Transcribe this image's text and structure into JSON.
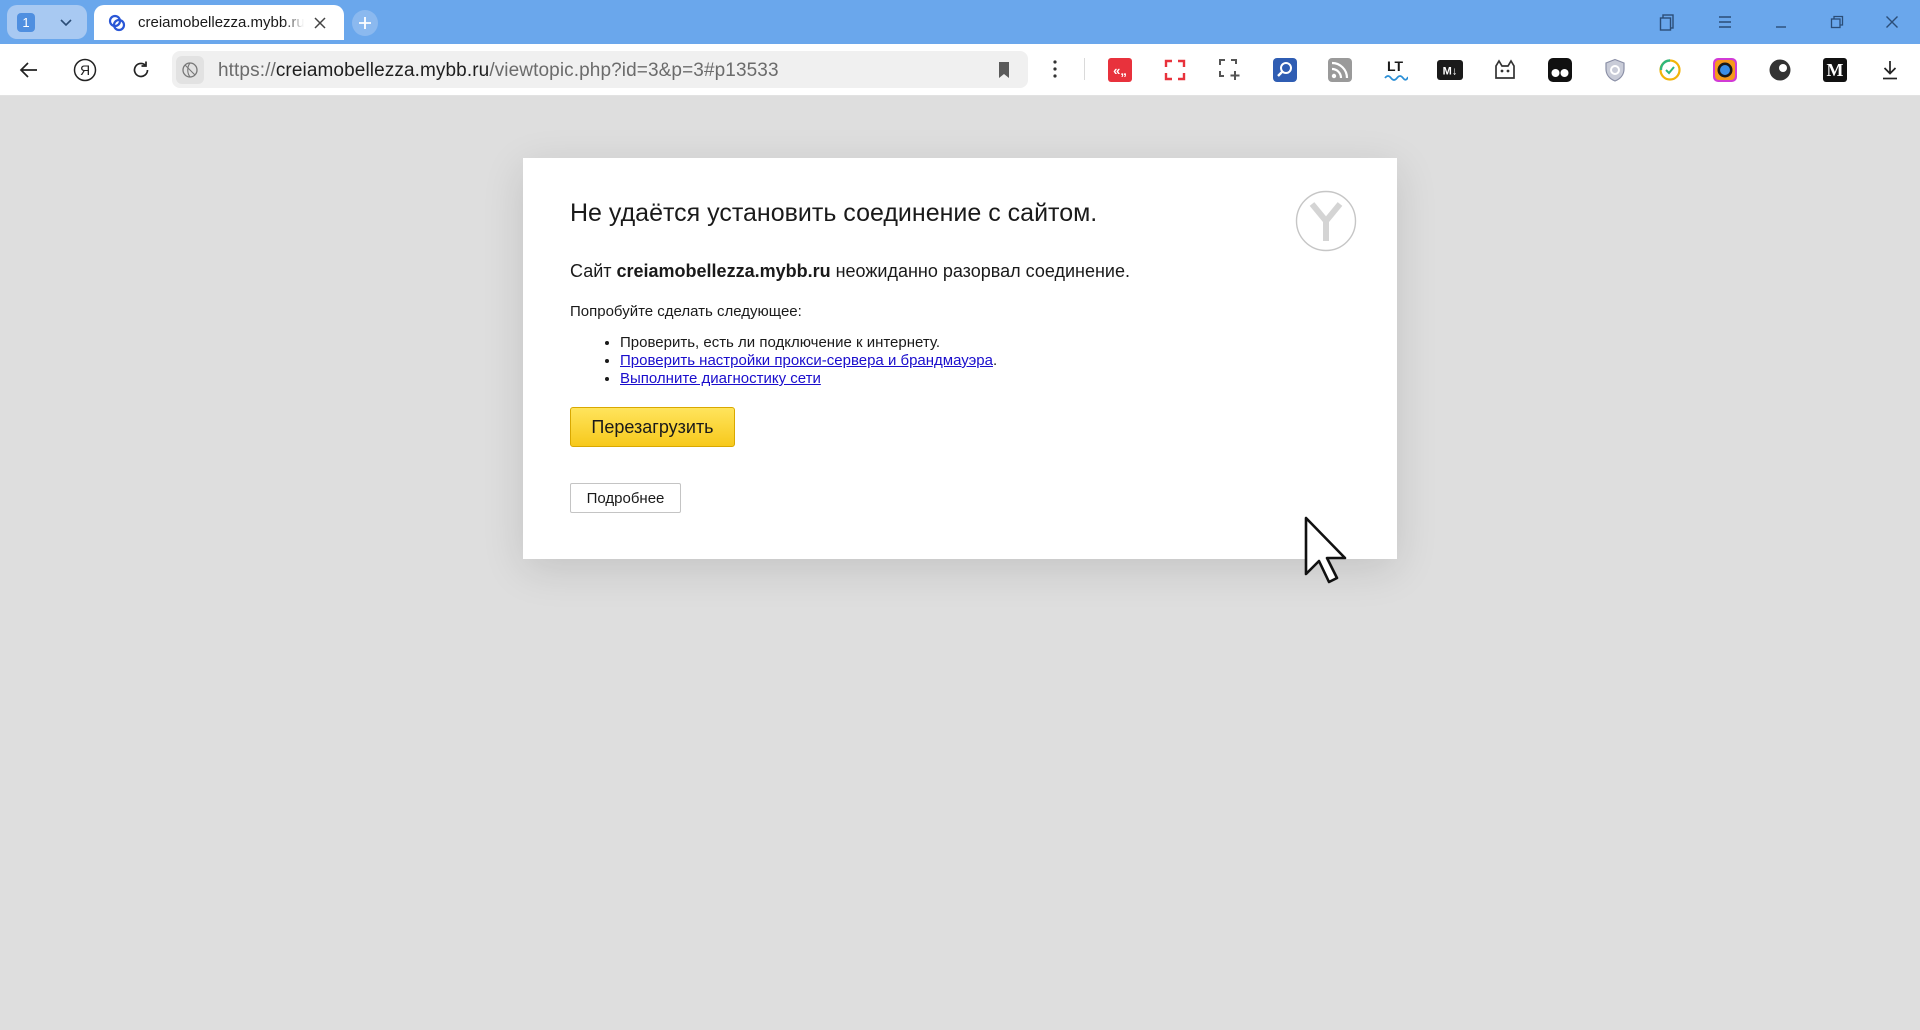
{
  "tabs": {
    "count": "1",
    "active_tab_title": "creiamobellezza.mybb.ru"
  },
  "toolbar": {
    "url_scheme": "https://",
    "url_host": "creiamobellezza.mybb.ru",
    "url_path": "/viewtopic.php?id=3&p=3#p13533",
    "yandex_button_glyph": "Я"
  },
  "extensions": [
    {
      "name": "quote-extension-icon",
      "glyph": "«„",
      "color": "#e8323c"
    },
    {
      "name": "fullscreen-extension-icon",
      "color": "#e8323c"
    },
    {
      "name": "screenshot-extension-icon",
      "color": "#555555"
    },
    {
      "name": "search-extension-icon",
      "color": "#2f5db3"
    },
    {
      "name": "rss-extension-icon",
      "color": "#8a8a8a"
    },
    {
      "name": "lt-extension-icon",
      "glyph": "LT",
      "color": "#1a1a1a"
    },
    {
      "name": "markdown-extension-icon",
      "glyph": "M↓",
      "color": "#1a1a1a"
    },
    {
      "name": "cat-extension-icon",
      "color": "#333333"
    },
    {
      "name": "tampermonkey-extension-icon",
      "color": "#111111"
    },
    {
      "name": "shield-extension-icon",
      "color": "#8a8fa6"
    },
    {
      "name": "timer-extension-icon",
      "color": "#f2b40a"
    },
    {
      "name": "color-picker-extension-icon",
      "color": "#d13bd6"
    },
    {
      "name": "dark-mode-extension-icon",
      "color": "#333333"
    },
    {
      "name": "medium-extension-icon",
      "glyph": "M",
      "color": "#111111"
    }
  ],
  "error": {
    "title": "Не удаётся установить соединение с сайтом.",
    "subtitle_prefix": "Сайт ",
    "subtitle_host": "creiamobellezza.mybb.ru",
    "subtitle_suffix": " неожиданно разорвал соединение.",
    "try_text": "Попробуйте сделать следующее:",
    "suggestions": [
      {
        "text": "Проверить, есть ли подключение к интернету.",
        "link": false
      },
      {
        "text": "Проверить настройки прокси-сервера и брандмауэра",
        "link": true,
        "suffix": "."
      },
      {
        "text": "Выполните диагностику сети",
        "link": true,
        "suffix": ""
      }
    ],
    "reload_label": "Перезагрузить",
    "details_label": "Подробнее"
  },
  "colors": {
    "tabstrip": "#6aa7ec",
    "page_background": "#dedede",
    "reload_button": "#f9d231",
    "link": "#1a0dcc"
  }
}
